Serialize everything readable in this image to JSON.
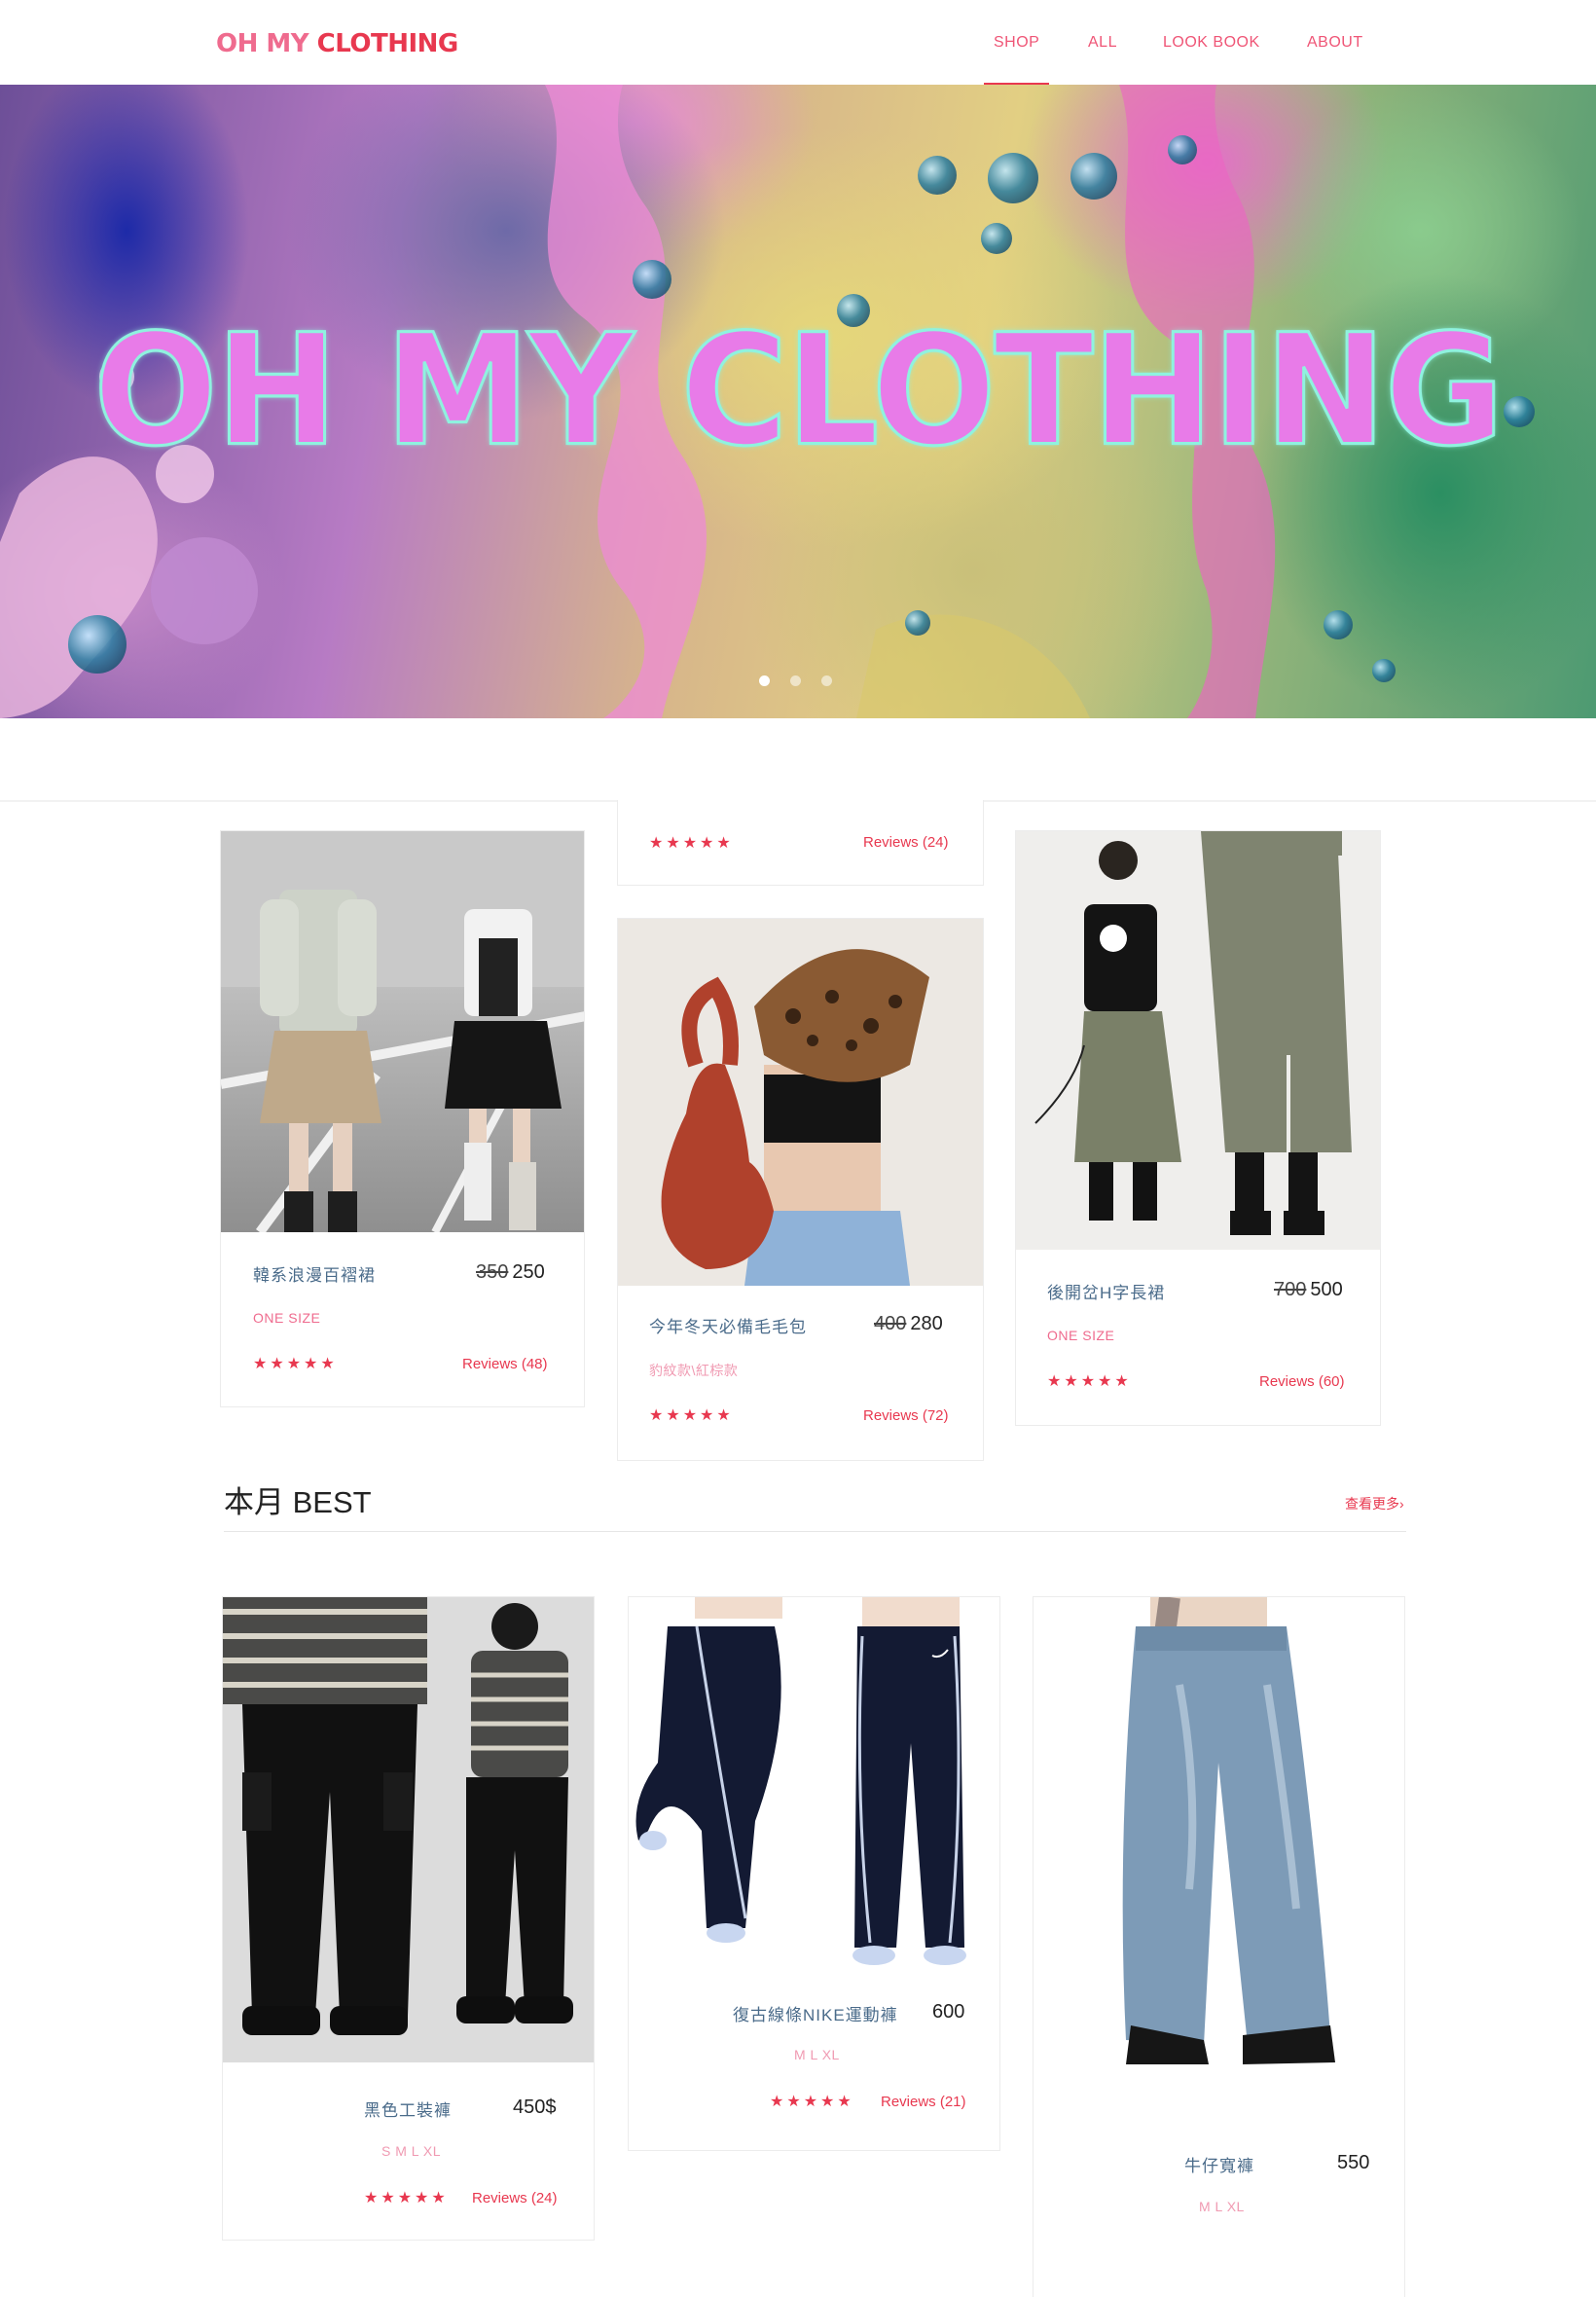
{
  "nav": {
    "logo_part1": "OH MY ",
    "logo_part2": "CLOTHING",
    "items": [
      "SHOP",
      "ALL",
      "LOOK BOOK",
      "ABOUT"
    ],
    "active": "SHOP"
  },
  "hero": {
    "title": "OH MY CLOTHING",
    "slides": 3,
    "active_slide": 1
  },
  "top_products": [
    {
      "name": "韓系浪漫百褶裙",
      "old_price": "350",
      "price": "250",
      "size": "ONE SIZE",
      "stars": "★★★★★",
      "reviews": "Reviews (48)"
    },
    {
      "name": "",
      "old_price": "",
      "price": "",
      "size": "",
      "stars": "★★★★★",
      "reviews": "Reviews (24)"
    },
    {
      "name": "今年冬天必備毛毛包",
      "old_price": "400",
      "price": "280",
      "size": "豹紋款\\紅棕款",
      "stars": "★★★★★",
      "reviews": "Reviews (72)"
    },
    {
      "name": "後開岔H字長裙",
      "old_price": "700",
      "price": "500",
      "size": "ONE SIZE",
      "stars": "★★★★★",
      "reviews": "Reviews (60)"
    }
  ],
  "best_section": {
    "title": "本月 BEST",
    "see_more": "查看更多›"
  },
  "best_products": [
    {
      "name": "黑色工裝褲",
      "price": "450$",
      "size": "S M L XL",
      "stars": "★★★★★",
      "reviews": "Reviews (24)"
    },
    {
      "name": "復古線條NIKE運動褲",
      "price": "600",
      "size": "M L XL",
      "stars": "★★★★★",
      "reviews": "Reviews (21)"
    },
    {
      "name": "牛仔寬褲",
      "price": "550",
      "size": "M L XL"
    }
  ],
  "colors": {
    "brand_pink": "#ef6b8e",
    "brand_red": "#e8384f",
    "name_blue": "#4a6b8a"
  }
}
